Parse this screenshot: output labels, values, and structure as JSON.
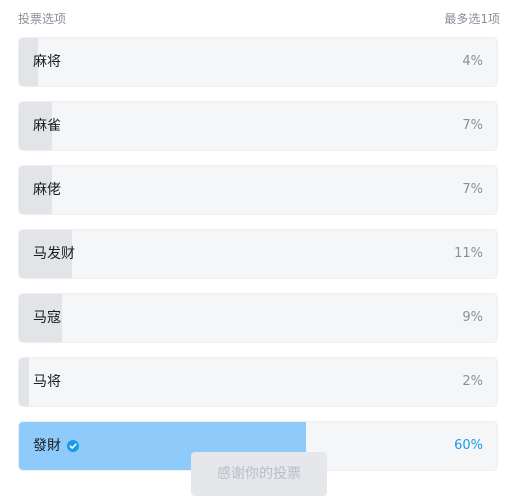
{
  "header": {
    "title": "投票选项",
    "limit": "最多选1项"
  },
  "options": [
    {
      "label": "麻将",
      "percent_text": "4%",
      "percent": 4,
      "selected": false
    },
    {
      "label": "麻雀",
      "percent_text": "7%",
      "percent": 7,
      "selected": false
    },
    {
      "label": "麻佬",
      "percent_text": "7%",
      "percent": 7,
      "selected": false
    },
    {
      "label": "马发财",
      "percent_text": "11%",
      "percent": 11,
      "selected": false
    },
    {
      "label": "马寇",
      "percent_text": "9%",
      "percent": 9,
      "selected": false
    },
    {
      "label": "马将",
      "percent_text": "2%",
      "percent": 2,
      "selected": false
    },
    {
      "label": "發財",
      "percent_text": "60%",
      "percent": 60,
      "selected": true,
      "icon": "check-circle-icon"
    }
  ],
  "vote_button": {
    "label": "感谢你的投票",
    "disabled": true
  },
  "colors": {
    "fill": "#e2e4e7",
    "selected_fill": "#8ecbfb",
    "selected_text": "#1a9ae8",
    "check": "#1a9ae8"
  }
}
